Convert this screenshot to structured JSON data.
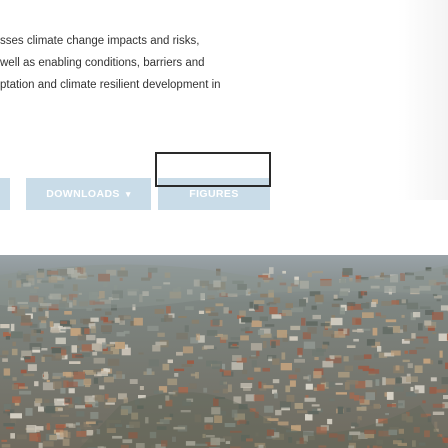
{
  "intro": {
    "line1": "sses climate change impacts and risks,",
    "line2": "well as enabling conditions, barriers and",
    "line3": "ptation and climate resilient development in"
  },
  "buttons": {
    "stub_label": "",
    "downloads_label": "DOWNLOADS",
    "downloads_caret": "▾",
    "figures_label": "FIGURES"
  },
  "colors": {
    "button_bg": "#c9dce8",
    "button_text": "#ffffff",
    "focus_outline": "#2a2a2a",
    "body_text": "#333333"
  },
  "hero": {
    "image": "aerial-city-favela-photo",
    "icon": "photo-icon"
  }
}
